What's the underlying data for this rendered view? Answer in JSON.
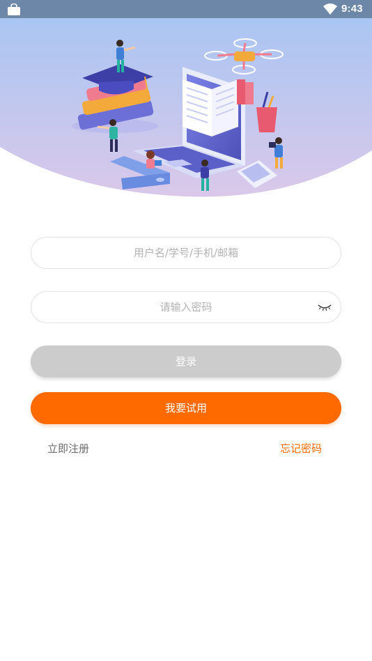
{
  "status_bar": {
    "time": "9:43",
    "icons": [
      "shopping-bag-icon",
      "wifi-icon"
    ]
  },
  "hero": {
    "illustration": "education-laptop-illustration",
    "gradient_colors": [
      "#a9c6f2",
      "#d7c6ec"
    ]
  },
  "form": {
    "username_placeholder": "用户名/学号/手机/邮箱",
    "password_placeholder": "请输入密码",
    "password_toggle_icon": "eye-closed-icon"
  },
  "buttons": {
    "login_label": "登录",
    "trial_label": "我要试用"
  },
  "links": {
    "register": "立即注册",
    "forgot_password": "忘记密码"
  },
  "colors": {
    "accent": "#ff6a00",
    "login_disabled": "#cccccc",
    "status_bar": "#6d87a8"
  }
}
